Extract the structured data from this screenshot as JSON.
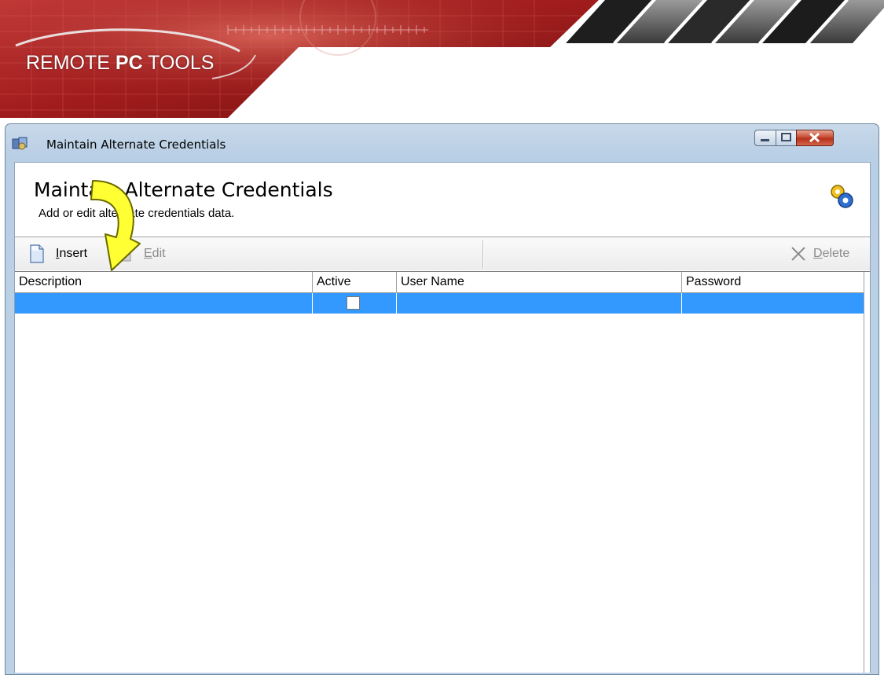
{
  "banner": {
    "logo_light": "REMOTE ",
    "logo_bold": "PC",
    "logo_tail": " TOOLS"
  },
  "window": {
    "title": "Maintain Alternate Credentials",
    "controls": [
      "minimize",
      "maximize",
      "close"
    ]
  },
  "header": {
    "title": "Maintain Alternate Credentials",
    "subtitle": "Add or edit alternate credentials data.",
    "icon": "gears-icon"
  },
  "toolbar": {
    "insert_label_u": "I",
    "insert_label_rest": "nsert",
    "edit_label_u": "E",
    "edit_label_rest": "dit",
    "delete_label_u": "D",
    "delete_label_rest": "elete"
  },
  "grid": {
    "columns": [
      "Description",
      "Active",
      "User Name",
      "Password"
    ],
    "rows": [
      {
        "description": "",
        "active": false,
        "user_name": "",
        "password": "",
        "selected": true
      }
    ]
  },
  "colors": {
    "selection": "#3399ff",
    "banner_red": "#9a1818",
    "arrow_yellow": "#ffff33"
  }
}
